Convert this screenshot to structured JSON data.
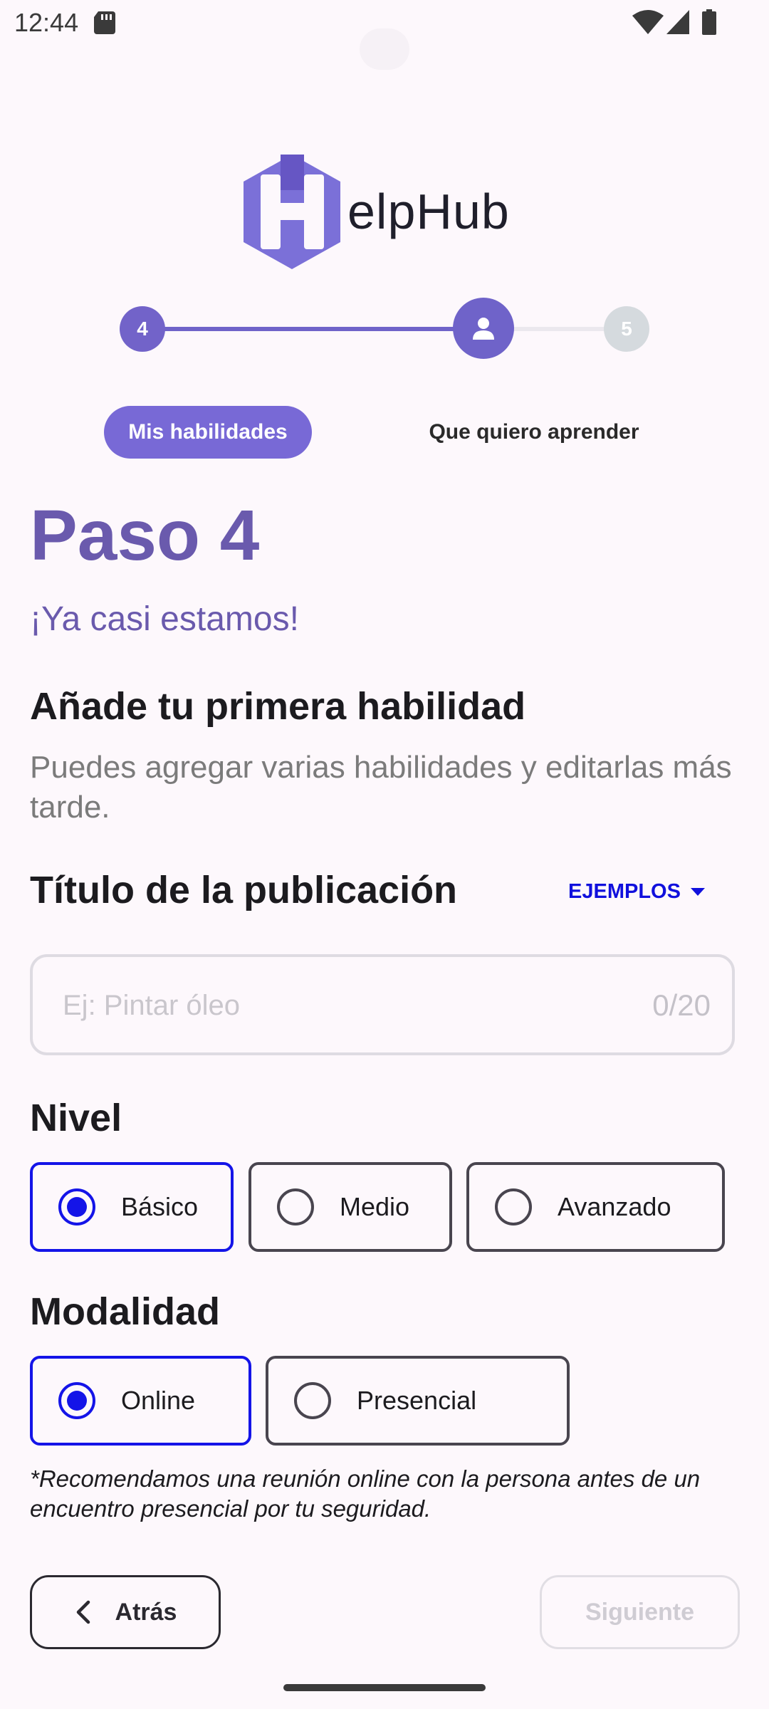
{
  "status_bar": {
    "time": "12:44",
    "icons": [
      "sd-card-icon",
      "wifi-icon",
      "signal-icon",
      "battery-icon"
    ]
  },
  "logo": {
    "text": "elpHub",
    "mark_letter": "H",
    "mark_color": "#7b70d8"
  },
  "stepper": {
    "previous_step": "4",
    "current_step_icon": "person-icon",
    "next_step": "5",
    "progress_color": "#6f63c9"
  },
  "tabs": [
    {
      "label": "Mis habilidades",
      "active": true
    },
    {
      "label": "Que quiero aprender",
      "active": false
    }
  ],
  "main": {
    "title": "Paso 4",
    "subtitle": "¡Ya casi estamos!",
    "section_heading": "Añade tu primera habilidad",
    "section_description": "Puedes agregar varias habilidades y editarlas más tarde."
  },
  "publication_title": {
    "label": "Título de la publicación",
    "examples_label": "EJEMPLOS",
    "placeholder": "Ej: Pintar óleo",
    "value": "",
    "counter": "0/20"
  },
  "level": {
    "label": "Nivel",
    "options": [
      "Básico",
      "Medio",
      "Avanzado"
    ],
    "selected": "Básico"
  },
  "mode": {
    "label": "Modalidad",
    "options": [
      "Online",
      "Presencial"
    ],
    "selected": "Online"
  },
  "note": "*Recomendamos una reunión online con la persona antes de un encuentro presencial por tu seguridad.",
  "navigation": {
    "back_label": "Atrás",
    "next_label": "Siguiente",
    "next_enabled": false
  },
  "colors": {
    "accent": "#6a5aad",
    "selection": "#1414e8",
    "background": "#fdf8fc"
  }
}
